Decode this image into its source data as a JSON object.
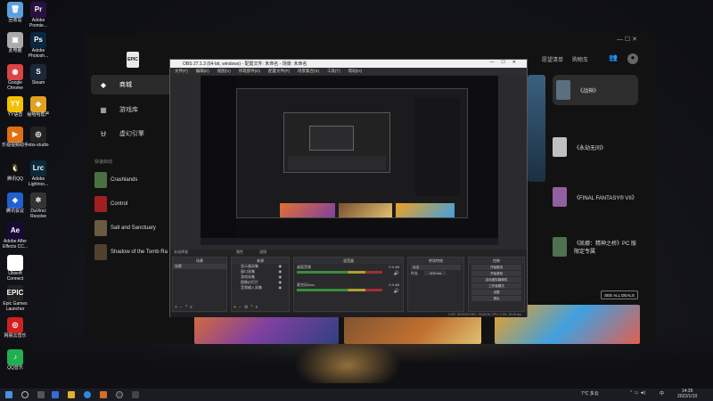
{
  "desktop": {
    "icons": [
      {
        "label": "回收站",
        "icon": "recycle-bin-icon",
        "color": "#5aa0e0",
        "glyph": "🗑"
      },
      {
        "label": "Adobe Premie...",
        "icon": "premiere-icon",
        "color": "#2a1040",
        "glyph": "Pr"
      },
      {
        "label": "此电脑",
        "icon": "computer-icon",
        "color": "#aaa",
        "glyph": "▣"
      },
      {
        "label": "Adobe Photosh...",
        "icon": "photoshop-icon",
        "color": "#0b2740",
        "glyph": "Ps"
      },
      {
        "label": "Google Chrome",
        "icon": "chrome-icon",
        "color": "#d44",
        "glyph": "◉"
      },
      {
        "label": "Steam",
        "icon": "steam-icon",
        "color": "#1b2838",
        "glyph": "S"
      },
      {
        "label": "YY语音",
        "icon": "yy-icon",
        "color": "#f5c000",
        "glyph": "YY"
      },
      {
        "label": "秘哈哈帮严",
        "icon": "app-icon",
        "color": "#e0a020",
        "glyph": "◆"
      },
      {
        "label": "乐视视频助手",
        "icon": "video-icon",
        "color": "#e07010",
        "glyph": "▶"
      },
      {
        "label": "obs-studio",
        "icon": "obs-icon",
        "color": "#222",
        "glyph": "◎"
      },
      {
        "label": "腾讯QQ",
        "icon": "qq-icon",
        "color": "#111",
        "glyph": "🐧"
      },
      {
        "label": "Adobe Lightroo...",
        "icon": "lightroom-icon",
        "color": "#0a2a3a",
        "glyph": "Lrc"
      },
      {
        "label": "腾讯会议",
        "icon": "meeting-icon",
        "color": "#2060d0",
        "glyph": "◈"
      },
      {
        "label": "DaVinci Resolve",
        "icon": "davinci-icon",
        "color": "#333",
        "glyph": "✲"
      },
      {
        "label": "Adobe After Effects CC...",
        "icon": "after-effects-icon",
        "color": "#1a0a3a",
        "glyph": "Ae"
      },
      {
        "label": "Ubisoft Connect",
        "icon": "ubisoft-icon",
        "color": "#fff",
        "glyph": "◐"
      },
      {
        "label": "Epic Games Launcher",
        "icon": "epic-icon",
        "color": "#222",
        "glyph": "EPIC"
      },
      {
        "label": "网易云音乐",
        "icon": "netease-music-icon",
        "color": "#d02020",
        "glyph": "◎"
      },
      {
        "label": "QQ音乐",
        "icon": "qq-music-icon",
        "color": "#20b050",
        "glyph": "♪"
      }
    ]
  },
  "epic": {
    "logo": "EPIC",
    "nav": [
      {
        "label": "商城",
        "glyph": "◆",
        "active": true
      },
      {
        "label": "游戏库",
        "glyph": "▦",
        "active": false
      },
      {
        "label": "虚幻引擎",
        "glyph": "Ʉ",
        "active": false
      }
    ],
    "recent_label": "快速启动",
    "recent": [
      {
        "label": "Crashlands",
        "color": "#4a7040"
      },
      {
        "label": "Control",
        "color": "#a02020"
      },
      {
        "label": "Salt and Sanctuary",
        "color": "#6a5a40"
      },
      {
        "label": "Shadow of the Tomb Ra",
        "color": "#504030"
      }
    ],
    "top_links": [
      "愿望清单",
      "购物车"
    ],
    "sales": [
      {
        "label": "《战神》",
        "color": "#5a7080",
        "active": true
      },
      {
        "label": "《永劫无间》",
        "color": "#c0c0c0",
        "active": false
      },
      {
        "label": "《FINAL FANTASY® VII》",
        "color": "#9060a0",
        "active": false
      },
      {
        "label": "《凯娜：精神之桥》PC 版限定专属",
        "color": "#507050",
        "active": false
      }
    ],
    "all_deals": "SEE ALL DEALS",
    "winbtns": "— ☐ ✕"
  },
  "obs": {
    "title": "OBS 27.1.3 (64-bit, windows) - 配置文件: 未命名 - 场景: 未命名",
    "menu": [
      "文件(F)",
      "编辑(E)",
      "视图(V)",
      "停靠部件(D)",
      "配置文件(P)",
      "场景集合(S)",
      "工具(T)",
      "帮助(H)"
    ],
    "docks": {
      "scenes": "场景",
      "sources": "来源",
      "mixer": "混音器",
      "transitions": "转场特效",
      "controls": "控制"
    },
    "scene_item": "场景",
    "sources": [
      "显示器采集",
      "窗口采集",
      "游戏采集",
      "图像幻灯片",
      "音频输入采集"
    ],
    "mixer": [
      {
        "name": "桌面音频",
        "db": "0.0 dB"
      },
      {
        "name": "麦克风/Aux",
        "db": "0.0 dB"
      }
    ],
    "transition": {
      "name": "淡出",
      "duration_label": "时长",
      "duration": "300 ms"
    },
    "controls": [
      "开始推流",
      "开始录制",
      "启动虚拟摄像机",
      "工作室模式",
      "设置",
      "退出"
    ],
    "status": "LIVE: 00:00:00   REC: 00:00:00   CPU: 2.3%, 30.00 fps",
    "no_source": "未选择源",
    "props": "属性",
    "filters": "滤镜"
  },
  "taskbar": {
    "weather": "7°C 多云",
    "time": "14:39",
    "date": "2022/1/10",
    "lang": "中"
  }
}
